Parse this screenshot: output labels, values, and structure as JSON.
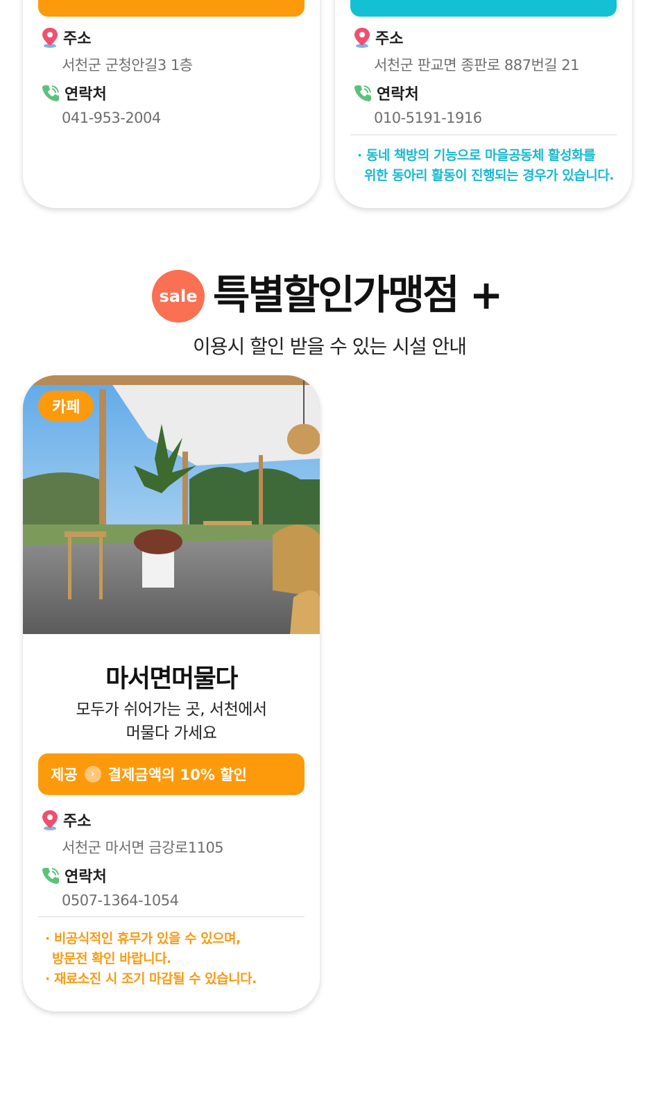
{
  "top_left_card": {
    "address_label": "주소",
    "address": "서천군 군청안길3 1층",
    "contact_label": "연락처",
    "phone": "041-953-2004"
  },
  "top_right_card": {
    "address_label": "주소",
    "address": "서천군 판교면 종판로 887번길 21",
    "contact_label": "연락처",
    "phone": "010-5191-1916",
    "notes": [
      "· 동네 책방의 기능으로 마을공동체 활성화를",
      "위한 동아리 활동이 진행되는 경우가 있습니다."
    ]
  },
  "section": {
    "badge": "sale",
    "title": "특별할인가맹점 +",
    "subtitle": "이용시 할인 받을 수 있는 시설 안내"
  },
  "cafe_card": {
    "category_tag": "카페",
    "name": "마서면머물다",
    "description": [
      "모두가 쉬어가는 곳, 서천에서",
      "머물다 가세요"
    ],
    "offer_label": "제공",
    "offer_text": "결제금액의 10% 할인",
    "address_label": "주소",
    "address": "서천군 마서면 금강로1105",
    "contact_label": "연락처",
    "phone": "0507-1364-1054",
    "notes": [
      "· 비공식적인 휴무가 있을 수 있으며,",
      "방문전 확인 바랍니다.",
      "· 재료소진 시 조기 마감될 수 있습니다."
    ]
  },
  "colors": {
    "orange": "#fd9a0c",
    "cyan": "#14c0d3",
    "sale_red": "#fa7052"
  },
  "icons": {
    "pin": "location-pin-icon",
    "phone": "phone-icon",
    "arrow": "chevron-right-icon"
  }
}
